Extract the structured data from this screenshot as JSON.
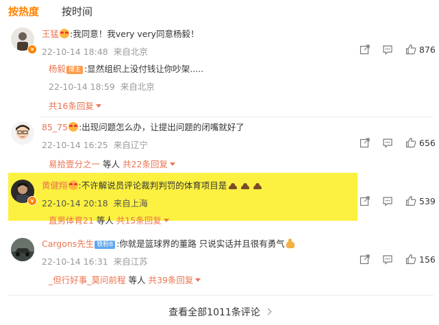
{
  "tabs": {
    "hot": "按热度",
    "time": "按时间"
  },
  "comments": [
    {
      "user": "王猛",
      "text_before": ":我同意！我very very同意杨毅！",
      "meta": "22-10-14 18:48",
      "location": "来自北京",
      "likes": "876",
      "reply": {
        "user": "杨毅",
        "tag": "博主",
        "text": ":显然组织上没付钱让你吵架.....",
        "meta": "22-10-14 18:59",
        "location": "来自北京"
      },
      "more": "共16条回复"
    },
    {
      "user": "85_75",
      "text": ":出现问题怎么办，让提出问题的闭嘴就好了",
      "meta": "22-10-14 16:25",
      "location": "来自辽宁",
      "likes": "656",
      "more_user": "易拾壹分之一",
      "more_mid": " 等人 ",
      "more": "共22条回复"
    },
    {
      "user": "黄健翔",
      "text": ":不许解说员评论裁判判罚的体育项目是",
      "meta": "22-10-14 20:18",
      "location": "来自上海",
      "likes": "539",
      "more_user": "直男体育21",
      "more_mid": " 等人 ",
      "more": "共15条回复"
    },
    {
      "user": "Cargons先生",
      "tag": "铁粉8",
      "text": ":你就是篮球界的董路 只说实话并且很有勇气",
      "meta": "22-10-14 16:31",
      "location": "来自江苏",
      "likes": "156",
      "more_user": "_但行好事_莫问前程",
      "more_mid": " 等人 ",
      "more": "共39条回复"
    }
  ],
  "view_all": "查看全部1011条评论",
  "colors": {
    "accent": "#ff8200",
    "name": "#eb7350",
    "highlight": "#fcf140"
  },
  "icons": [
    "share-icon",
    "comment-icon",
    "like-icon",
    "chevron-right-icon",
    "chevron-down-icon"
  ]
}
